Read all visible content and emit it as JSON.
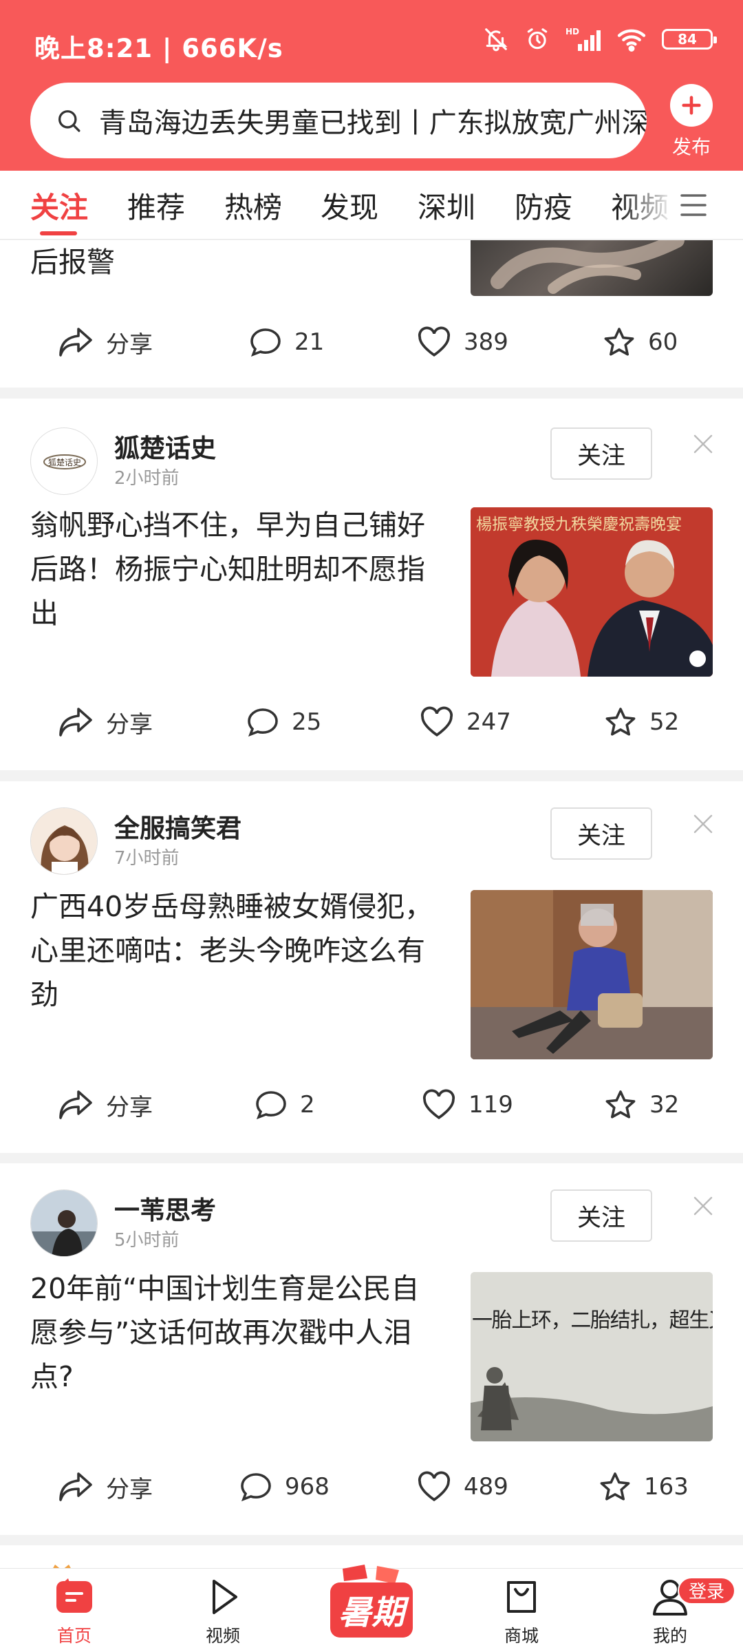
{
  "status_bar": {
    "text": "晚上8:21 | 666K/s",
    "battery": "84",
    "hd": "HD"
  },
  "search": {
    "text": "青岛海边丢失男童已找到丨广东拟放宽广州深"
  },
  "publish": {
    "label": "发布"
  },
  "tabs": [
    {
      "label": "关注",
      "active": true
    },
    {
      "label": "推荐"
    },
    {
      "label": "热榜"
    },
    {
      "label": "发现"
    },
    {
      "label": "深圳"
    },
    {
      "label": "防疫"
    },
    {
      "label": "视频"
    }
  ],
  "cards": [
    {
      "partial_title": "后报警",
      "share": "分享",
      "comments": "21",
      "likes": "389",
      "favorites": "60"
    },
    {
      "author": "狐楚话史",
      "time": "2小时前",
      "follow": "关注",
      "avatar_text": "狐楚话史",
      "title": "翁帆野心挡不住，早为自己铺好后路！杨振宁心知肚明却不愿指出",
      "thumb_caption": "楊振寧教授九秩榮慶祝壽晚宴",
      "share": "分享",
      "comments": "25",
      "likes": "247",
      "favorites": "52"
    },
    {
      "author": "全服搞笑君",
      "time": "7小时前",
      "follow": "关注",
      "title": "广西40岁岳母熟睡被女婿侵犯，心里还嘀咕：老头今晚咋这么有劲",
      "share": "分享",
      "comments": "2",
      "likes": "119",
      "favorites": "32"
    },
    {
      "author": "一苇思考",
      "time": "5小时前",
      "follow": "关注",
      "title": "20年前“中国计划生育是公民自愿参与”这话何故再次戳中人泪点?",
      "thumb_caption": "一胎上环，二胎结扎，超生又扎又罚",
      "share": "分享",
      "comments": "968",
      "likes": "489",
      "favorites": "163"
    }
  ],
  "bottom_nav": {
    "home": "首页",
    "video": "视频",
    "promo": "暑期",
    "mall": "商城",
    "me": "我的",
    "login": "登录"
  },
  "colors": {
    "brand": "#f85959",
    "accent": "#f04142"
  }
}
